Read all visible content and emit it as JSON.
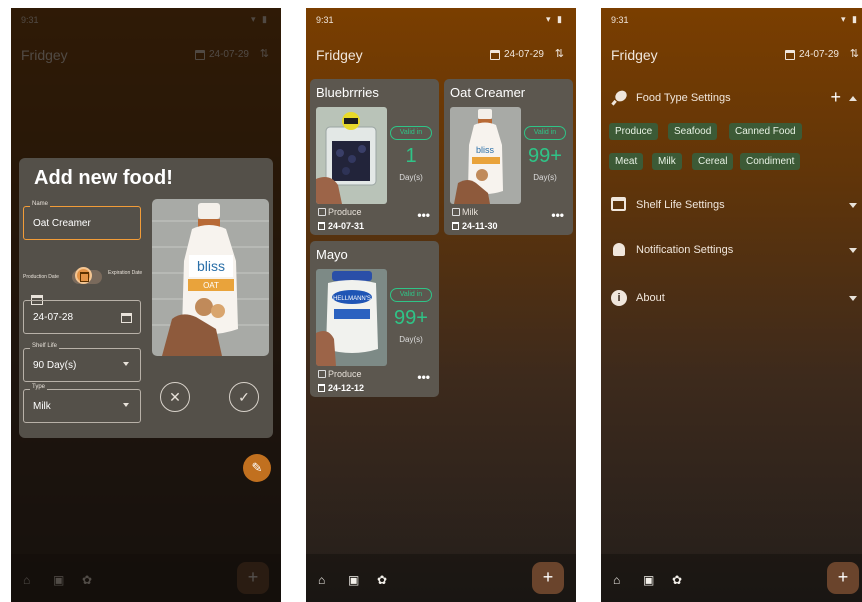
{
  "status_time": "9:31",
  "status_icons": "▾ ▮",
  "app": {
    "title": "Fridgey",
    "date": "24-07-29",
    "sort_icon": "⇅"
  },
  "bottom_nav": {
    "home": "⌂",
    "scan": "▣",
    "settings": "✿",
    "add": "+"
  },
  "dialog": {
    "title": "Add new food!",
    "name_label": "Name",
    "name_value": "Oat Creamer",
    "production_label": "Production Date",
    "expiration_label": "Expiration Date",
    "date_value": "24-07-28",
    "shelf_label": "Shelf Life",
    "shelf_value": "90 Day(s)",
    "type_label": "Type",
    "type_value": "Milk",
    "cancel": "✕",
    "confirm": "✓",
    "edit_fab": "✎"
  },
  "cards": [
    {
      "name": "Bluebrrries",
      "valid_label": "Valid in",
      "days": "1",
      "unit": "Day(s)",
      "type": "Produce",
      "date": "24-07-31",
      "more": "•••"
    },
    {
      "name": "Oat Creamer",
      "valid_label": "Valid in",
      "days": "99+",
      "unit": "Day(s)",
      "type": "Milk",
      "date": "24-11-30",
      "more": "•••"
    },
    {
      "name": "Mayo",
      "valid_label": "Valid in",
      "days": "99+",
      "unit": "Day(s)",
      "type": "Produce",
      "date": "24-12-12",
      "more": "•••"
    }
  ],
  "settings": {
    "food_type": "Food Type Settings",
    "add": "+",
    "chips": [
      "Produce",
      "Seafood",
      "Canned Food",
      "Meat",
      "Milk",
      "Cereal",
      "Condiment"
    ],
    "shelf_life": "Shelf Life Settings",
    "notification": "Notification Settings",
    "about": "About",
    "info_glyph": "i"
  },
  "colors": {
    "accent": "#f29c38",
    "valid_green": "#2fc487",
    "chip_bg": "#3c5a36",
    "card_bg": "#5c574f"
  }
}
